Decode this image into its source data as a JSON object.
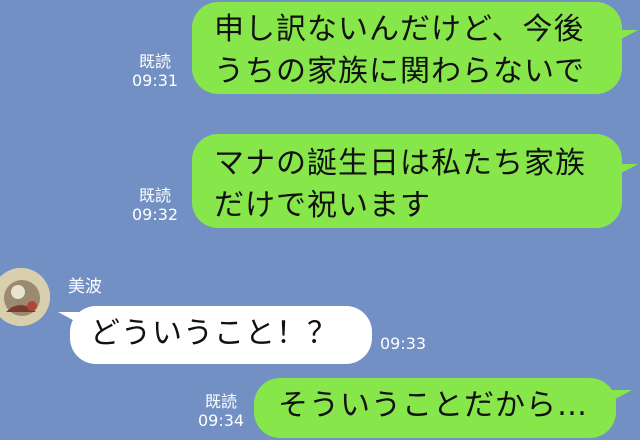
{
  "messages": [
    {
      "lines": [
        "申し訳ないんだけど、今後",
        "うちの家族に関わらないで"
      ],
      "read": "既読",
      "time": "09:31"
    },
    {
      "lines": [
        "マナの誕生日は私たち家族",
        "だけで祝います"
      ],
      "read": "既読",
      "time": "09:32"
    },
    {
      "sender": "美波",
      "lines": [
        "どういうこと！？"
      ],
      "time": "09:33"
    },
    {
      "lines": [
        "そういうことだから…"
      ],
      "read": "既読",
      "time": "09:34"
    }
  ],
  "colors": {
    "background": "#7290c3",
    "sent_bubble": "#87e64a",
    "received_bubble": "#ffffff"
  },
  "icons": {
    "avatar": "avatar-image"
  }
}
